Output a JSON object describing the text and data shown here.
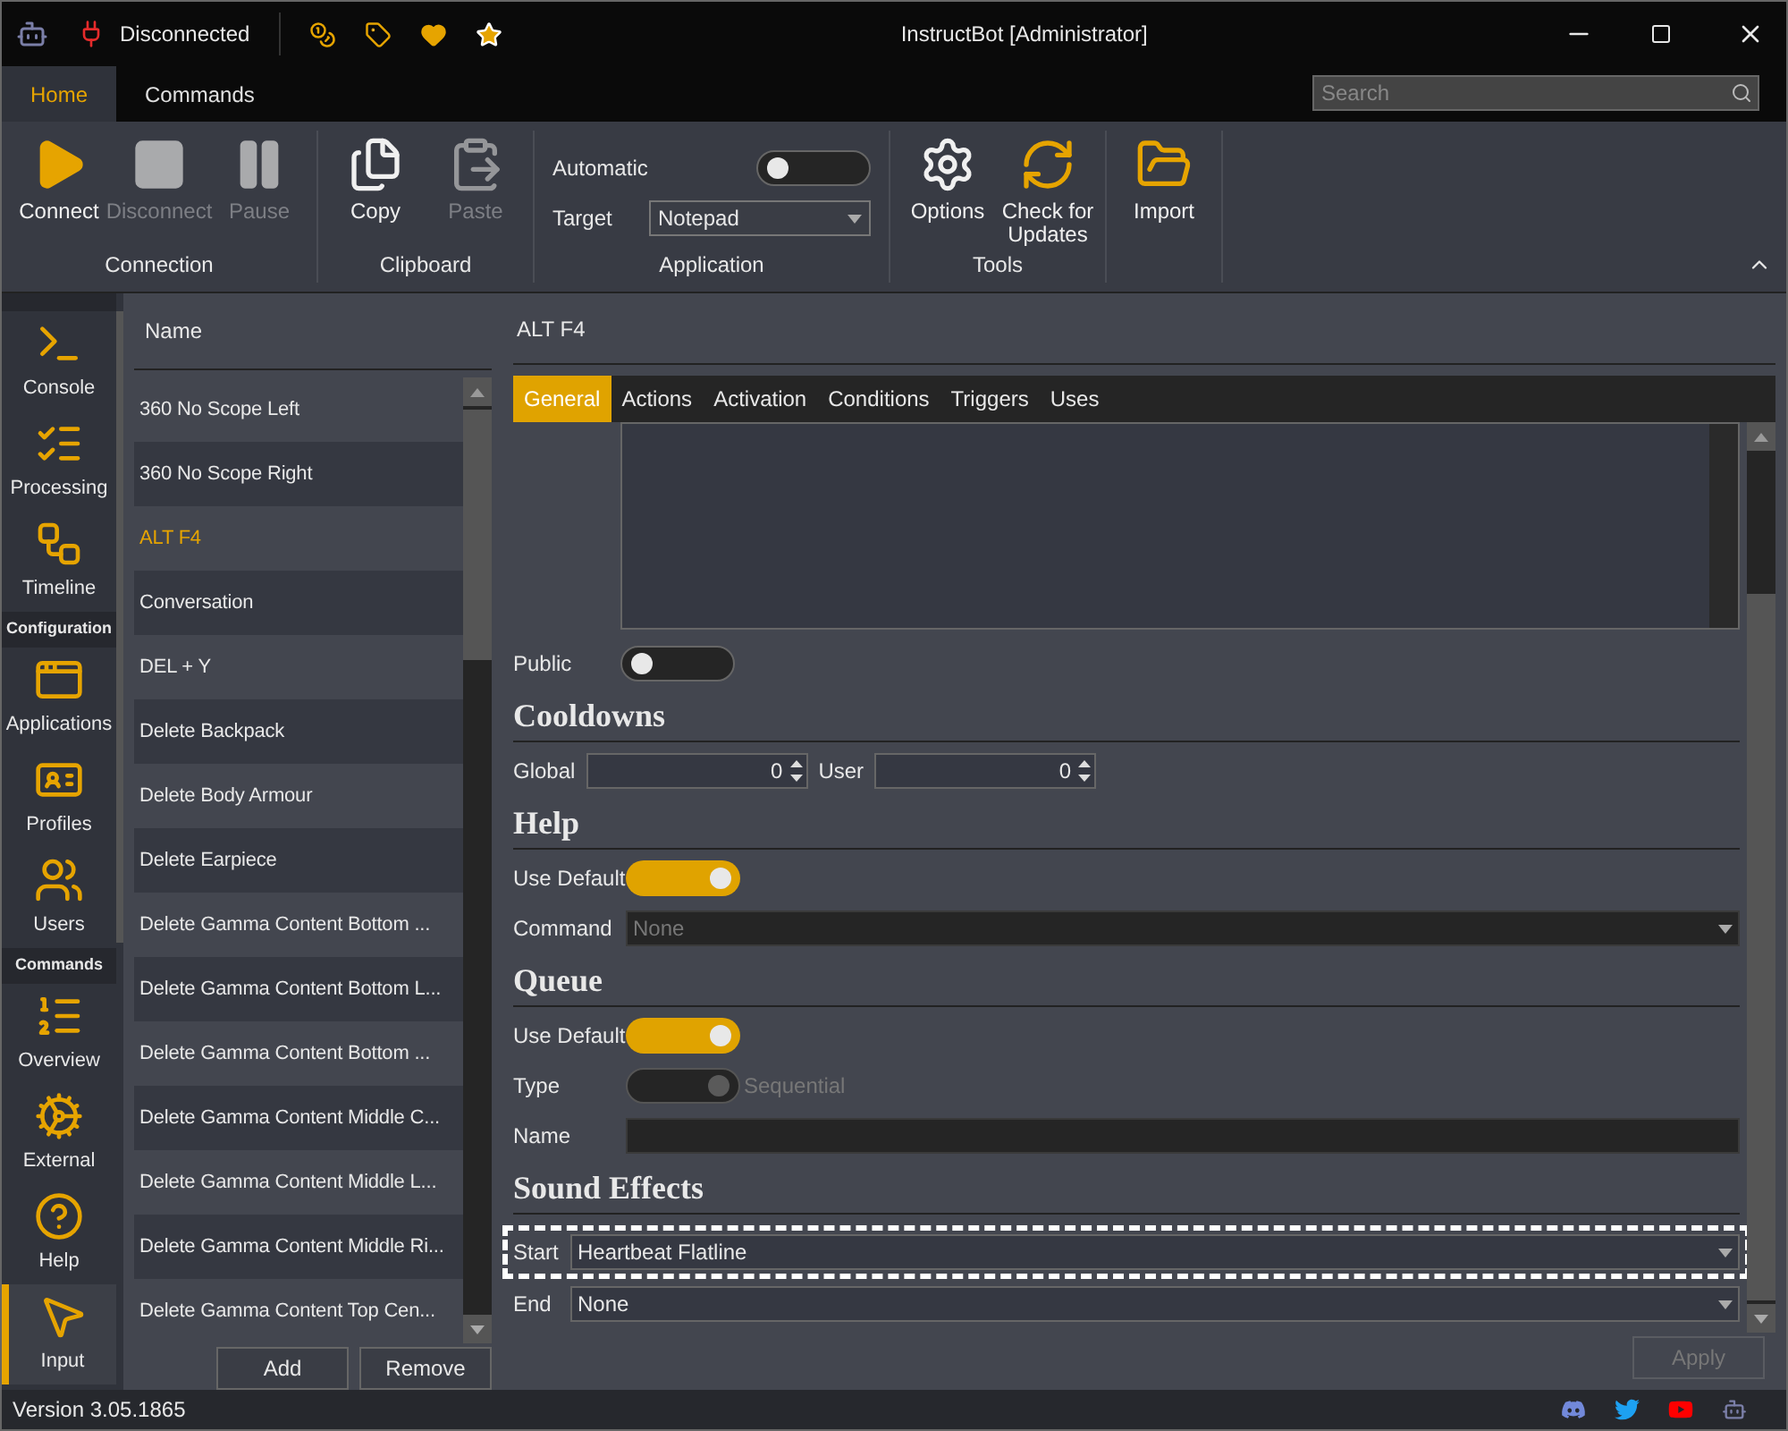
{
  "title_bar": {
    "status": "Disconnected",
    "title": "InstructBot [Administrator]"
  },
  "ribbon_tabs": [
    {
      "label": "Home",
      "selected": true
    },
    {
      "label": "Commands",
      "selected": false
    }
  ],
  "search": {
    "placeholder": "Search"
  },
  "ribbon_groups": [
    {
      "kind": "buttons",
      "label": "Connection",
      "buttons": [
        {
          "label": "Connect",
          "disabled": false
        },
        {
          "label": "Disconnect",
          "disabled": true
        },
        {
          "label": "Pause",
          "disabled": true
        }
      ]
    },
    {
      "kind": "buttons",
      "label": "Clipboard",
      "buttons": [
        {
          "label": "Copy",
          "disabled": false
        },
        {
          "label": "Paste",
          "disabled": true
        }
      ]
    },
    {
      "kind": "application",
      "label": "Application",
      "automatic": {
        "label": "Automatic",
        "on": false
      },
      "target": {
        "label": "Target",
        "value": "Notepad"
      }
    },
    {
      "kind": "buttons",
      "label": "Tools",
      "buttons": [
        {
          "label": "Options",
          "disabled": false
        },
        {
          "label": "Check for Updates",
          "disabled": false
        }
      ]
    },
    {
      "kind": "buttons",
      "buttons": [
        {
          "label": "Import",
          "disabled": false
        }
      ]
    }
  ],
  "nav": [
    {
      "kind": "item",
      "label": "Console",
      "selected": false
    },
    {
      "kind": "item",
      "label": "Processing",
      "selected": false
    },
    {
      "kind": "item",
      "label": "Timeline",
      "selected": false
    },
    {
      "kind": "header",
      "label": "Configuration"
    },
    {
      "kind": "item",
      "label": "Applications",
      "selected": false
    },
    {
      "kind": "item",
      "label": "Profiles",
      "selected": false
    },
    {
      "kind": "item",
      "label": "Users",
      "selected": false
    },
    {
      "kind": "header",
      "label": "Commands"
    },
    {
      "kind": "item",
      "label": "Overview",
      "selected": false
    },
    {
      "kind": "item",
      "label": "External",
      "selected": false
    },
    {
      "kind": "item",
      "label": "Help",
      "selected": false
    },
    {
      "kind": "item",
      "label": "Input",
      "selected": true
    }
  ],
  "command_list": {
    "column": "Name",
    "items": [
      {
        "label": "360 No Scope Left",
        "selected": false
      },
      {
        "label": "360 No Scope Right",
        "selected": false
      },
      {
        "label": "ALT F4",
        "selected": true
      },
      {
        "label": "Conversation",
        "selected": false
      },
      {
        "label": "DEL + Y",
        "selected": false
      },
      {
        "label": "Delete Backpack",
        "selected": false
      },
      {
        "label": "Delete Body Armour",
        "selected": false
      },
      {
        "label": "Delete Earpiece",
        "selected": false
      },
      {
        "label": "Delete Gamma Content Bottom ...",
        "selected": false
      },
      {
        "label": "Delete Gamma Content Bottom L...",
        "selected": false
      },
      {
        "label": "Delete Gamma Content Bottom ...",
        "selected": false
      },
      {
        "label": "Delete Gamma Content Middle C...",
        "selected": false
      },
      {
        "label": "Delete Gamma Content Middle L...",
        "selected": false
      },
      {
        "label": "Delete Gamma Content Middle Ri...",
        "selected": false
      },
      {
        "label": "Delete Gamma Content Top Cen...",
        "selected": false
      }
    ],
    "buttons": [
      "Add",
      "Remove"
    ]
  },
  "detail": {
    "title": "ALT F4",
    "tabs": [
      {
        "label": "General",
        "selected": true
      },
      {
        "label": "Actions",
        "selected": false
      },
      {
        "label": "Activation",
        "selected": false
      },
      {
        "label": "Conditions",
        "selected": false
      },
      {
        "label": "Triggers",
        "selected": false
      },
      {
        "label": "Uses",
        "selected": false
      }
    ],
    "public": {
      "label": "Public",
      "on": false
    },
    "sections": [
      {
        "heading": "Cooldowns",
        "rows": [
          {
            "kind": "spinners",
            "fields": [
              {
                "label": "Global",
                "value": "0"
              },
              {
                "label": "User",
                "value": "0"
              }
            ]
          }
        ]
      },
      {
        "heading": "Help",
        "rows": [
          {
            "kind": "toggle",
            "label": "Use Default",
            "on": true,
            "disabled": false
          },
          {
            "kind": "dropdown",
            "label": "Command",
            "value": "None",
            "disabled": true,
            "highlighted": false
          }
        ]
      },
      {
        "heading": "Queue",
        "rows": [
          {
            "kind": "toggle",
            "label": "Use Default",
            "on": true,
            "disabled": false
          },
          {
            "kind": "toggle",
            "label": "Type",
            "on": true,
            "disabled": true,
            "caption": "Sequential"
          },
          {
            "kind": "text",
            "label": "Name"
          }
        ]
      },
      {
        "heading": "Sound Effects",
        "rows": [
          {
            "kind": "dropdown",
            "label": "Start",
            "value": "Heartbeat Flatline",
            "disabled": false,
            "highlighted": true
          },
          {
            "kind": "dropdown",
            "label": "End",
            "value": "None",
            "disabled": false,
            "highlighted": false
          }
        ]
      }
    ],
    "apply": {
      "label": "Apply",
      "disabled": true
    }
  },
  "status_bar": {
    "version": "Version 3.05.1865"
  }
}
